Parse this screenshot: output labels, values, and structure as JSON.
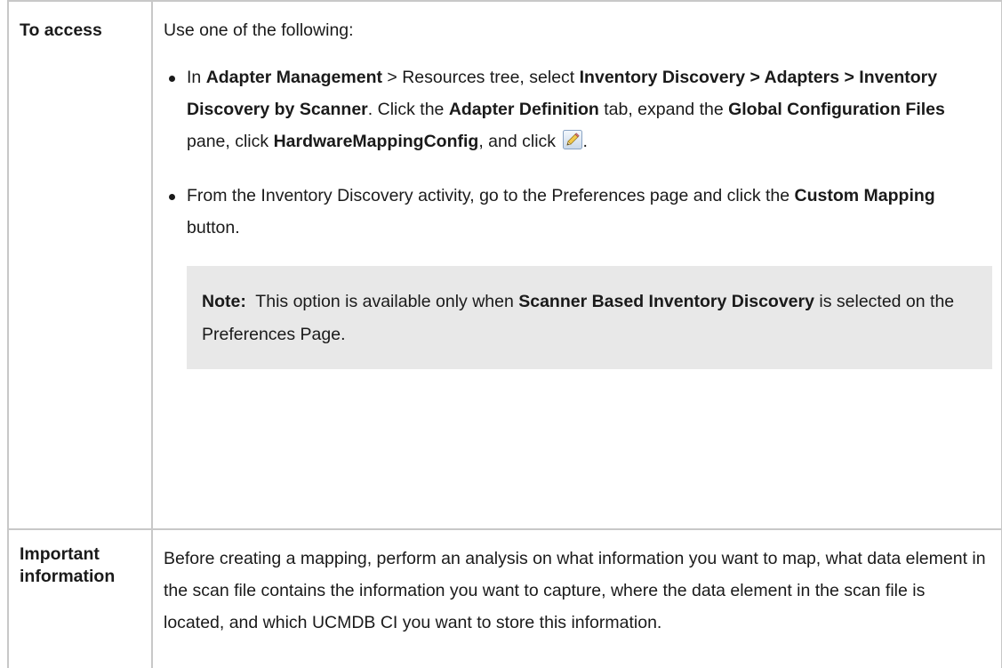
{
  "row1": {
    "label": "To access",
    "intro": "Use one of the following:",
    "bullet1": {
      "t1": "In ",
      "b1": "Adapter Management",
      "t2": " > Resources tree, select ",
      "b2": "Inventory Discovery > Adapters > Inventory Discovery by Scanner",
      "t3": ". Click the ",
      "b3": "Adapter Definition",
      "t4": " tab, expand the ",
      "b4": "Global Configuration Files",
      "t5": " pane, click ",
      "b5": "HardwareMappingConfig",
      "t6": ", and click ",
      "t7": ".",
      "icon": "pencil-edit-icon"
    },
    "bullet2": {
      "t1": "From the Inventory Discovery activity, go to the Preferences page and click the ",
      "b1": "Custom Mapping",
      "t2": " button."
    },
    "note": {
      "label": "Note:",
      "t1": "  This option is available only when ",
      "b1": "Scanner Based Inventory Discovery",
      "t2": " is selected on the Preferences Page."
    }
  },
  "row2": {
    "label": "Important information",
    "text": "Before creating a mapping, perform an analysis on what information you want to map, what data element in the scan file contains the information you want to capture, where the data element in the scan file is located, and which UCMDB CI you want to store this information."
  },
  "colors": {
    "border": "#c8c8c8",
    "note_background": "#e8e8e8",
    "text": "#1a1a1a"
  }
}
